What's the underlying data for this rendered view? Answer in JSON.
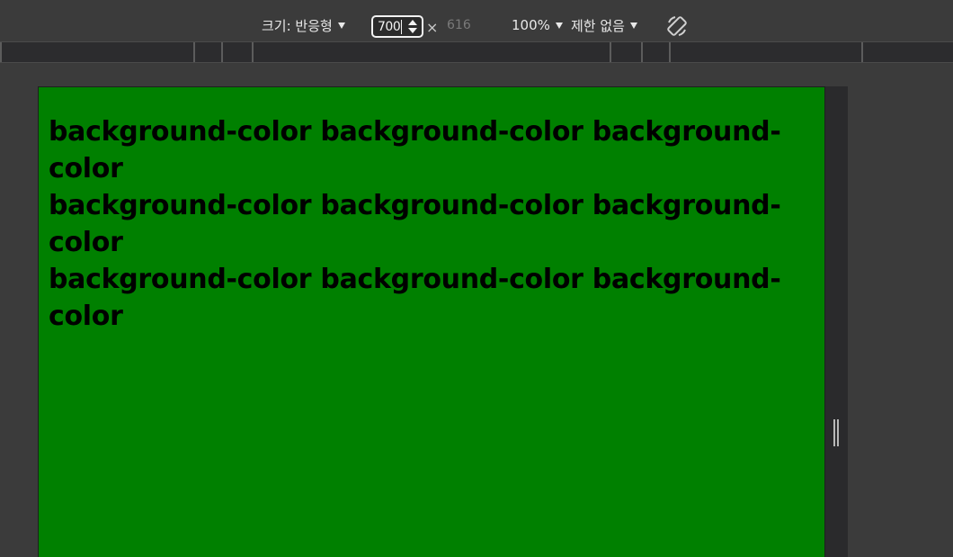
{
  "toolbar": {
    "dimensions_label": "크기: 반응형",
    "width_value": "700",
    "times_symbol": "×",
    "height_value": "616",
    "zoom_label": "100%",
    "throttle_label": "제한 없음",
    "rotate_icon": "rotate-icon"
  },
  "page": {
    "background_color": "#008000",
    "lines": [
      "background-color background-color background-color",
      "background-color background-color background-color",
      "background-color background-color background-color"
    ]
  }
}
